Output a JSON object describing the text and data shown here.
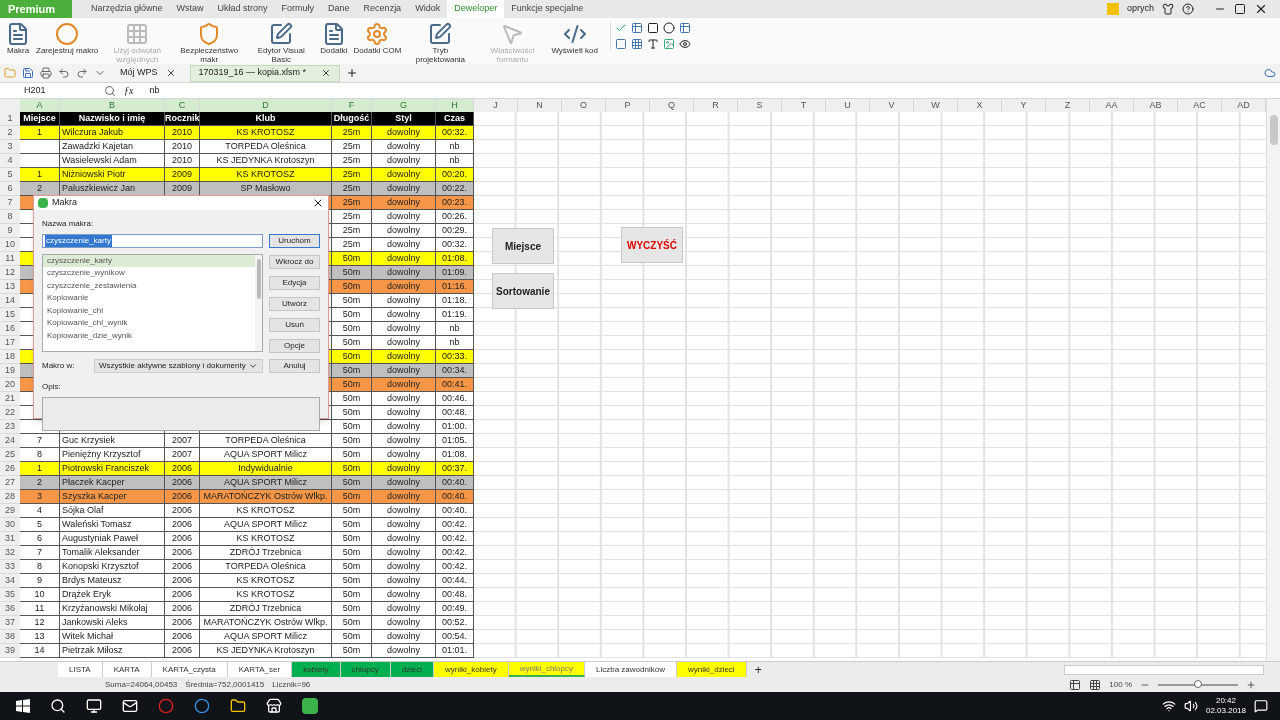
{
  "app": {
    "premium": "Premium",
    "user": "oprych"
  },
  "ribbon_tabs": [
    {
      "label": "Narzędzia główne",
      "selected": false
    },
    {
      "label": "Wstaw",
      "selected": false
    },
    {
      "label": "Układ strony",
      "selected": false
    },
    {
      "label": "Formuły",
      "selected": false
    },
    {
      "label": "Dane",
      "selected": false
    },
    {
      "label": "Recenzja",
      "selected": false
    },
    {
      "label": "Widok",
      "selected": false
    },
    {
      "label": "Deweloper",
      "selected": true
    },
    {
      "label": "Funkcje specjalne",
      "selected": false
    }
  ],
  "ribbon_buttons": [
    {
      "label": "Makra",
      "disabled": false,
      "kind": "macro"
    },
    {
      "label": "Zarejestruj makro",
      "disabled": false,
      "kind": "record"
    },
    {
      "label": "Użyj odwołań względnych",
      "disabled": true,
      "kind": "grid"
    },
    {
      "label": "Bezpieczeństwo makr",
      "disabled": false,
      "kind": "shield"
    },
    {
      "label": "Edytor Visual Basic",
      "disabled": false,
      "kind": "edit"
    },
    {
      "label": "Dodatki",
      "disabled": false,
      "kind": "addin"
    },
    {
      "label": "Dodatki COM",
      "disabled": false,
      "kind": "gear"
    },
    {
      "label": "Tryb projektowania",
      "disabled": false,
      "kind": "edit"
    },
    {
      "label": "Właściwości formantu",
      "disabled": true,
      "kind": "pointer"
    },
    {
      "label": "Wyświetl kod",
      "disabled": false,
      "kind": "code"
    }
  ],
  "doc_tabs": [
    {
      "label": "Mój WPS",
      "selected": false
    },
    {
      "label": "170319_16 — kopia.xlsm *",
      "selected": true
    }
  ],
  "name_box": "H201",
  "function_symbol": "ƒx",
  "formula": "nb",
  "columns": [
    {
      "label": "A",
      "selected": true
    },
    {
      "label": "B",
      "selected": true
    },
    {
      "label": "C",
      "selected": true
    },
    {
      "label": "D",
      "selected": true
    },
    {
      "label": "F",
      "selected": true
    },
    {
      "label": "G",
      "selected": true
    },
    {
      "label": "H",
      "selected": true
    },
    {
      "label": "J",
      "selected": false
    },
    {
      "label": "N",
      "selected": false
    },
    {
      "label": "O",
      "selected": false
    },
    {
      "label": "P",
      "selected": false
    },
    {
      "label": "Q",
      "selected": false
    },
    {
      "label": "R",
      "selected": false
    },
    {
      "label": "S",
      "selected": false
    },
    {
      "label": "T",
      "selected": false
    },
    {
      "label": "U",
      "selected": false
    },
    {
      "label": "V",
      "selected": false
    },
    {
      "label": "W",
      "selected": false
    },
    {
      "label": "X",
      "selected": false
    },
    {
      "label": "Y",
      "selected": false
    },
    {
      "label": "Z",
      "selected": false
    },
    {
      "label": "AA",
      "selected": false
    },
    {
      "label": "AB",
      "selected": false
    },
    {
      "label": "AC",
      "selected": false
    },
    {
      "label": "AD",
      "selected": false
    }
  ],
  "rows": [
    {
      "n": "1",
      "kind": "header",
      "color": "#000000",
      "miejsce": "Miejsce",
      "nazwisko": "Nazwisko i imię",
      "rocznik": "Rocznik",
      "klub": "Klub",
      "dlugosc": "Długość",
      "styl": "Styl",
      "czas": "Czas"
    },
    {
      "n": "2",
      "kind": "data",
      "color": "#ffff00",
      "miejsce": "1",
      "nazwisko": "Wilczura Jakub",
      "rocznik": "2010",
      "klub": "KS KROTOSZ",
      "dlugosc": "25m",
      "styl": "dowolny",
      "czas": "00:32."
    },
    {
      "n": "3",
      "kind": "data",
      "color": "#ffffff",
      "nazwisko": "Zawadzki Kajetan",
      "rocznik": "2010",
      "klub": "TORPEDA Oleśnica",
      "dlugosc": "25m",
      "styl": "dowolny",
      "czas": "nb"
    },
    {
      "n": "4",
      "kind": "data",
      "color": "#ffffff",
      "nazwisko": "Wasielewski Adam",
      "rocznik": "2010",
      "klub": "KS JEDYNKA Krotoszyn",
      "dlugosc": "25m",
      "styl": "dowolny",
      "czas": "nb"
    },
    {
      "n": "5",
      "kind": "data",
      "color": "#ffff00",
      "miejsce": "1",
      "nazwisko": "Niżniowski Piotr",
      "rocznik": "2009",
      "klub": "KS KROTOSZ",
      "dlugosc": "25m",
      "styl": "dowolny",
      "czas": "00:20."
    },
    {
      "n": "6",
      "kind": "data",
      "color": "#bfbfbf",
      "miejsce": "2",
      "nazwisko": "Paluszkiewicz Jan",
      "rocznik": "2009",
      "klub": "SP Masłowo",
      "dlugosc": "25m",
      "styl": "dowolny",
      "czas": "00:22."
    },
    {
      "n": "7",
      "kind": "data",
      "color": "#f79646",
      "dlugosc": "25m",
      "styl": "dowolny",
      "czas": "00:23."
    },
    {
      "n": "8",
      "kind": "data",
      "color": "#ffffff",
      "dlugosc": "25m",
      "styl": "dowolny",
      "czas": "00:26."
    },
    {
      "n": "9",
      "kind": "data",
      "color": "#ffffff",
      "dlugosc": "25m",
      "styl": "dowolny",
      "czas": "00:29."
    },
    {
      "n": "10",
      "kind": "data",
      "color": "#ffffff",
      "dlugosc": "25m",
      "styl": "dowolny",
      "czas": "00:32."
    },
    {
      "n": "11",
      "kind": "data",
      "color": "#ffff00",
      "dlugosc": "50m",
      "styl": "dowolny",
      "czas": "01:08."
    },
    {
      "n": "12",
      "kind": "data",
      "color": "#bfbfbf",
      "dlugosc": "50m",
      "styl": "dowolny",
      "czas": "01:09."
    },
    {
      "n": "13",
      "kind": "data",
      "color": "#f79646",
      "dlugosc": "50m",
      "styl": "dowolny",
      "czas": "01:16."
    },
    {
      "n": "14",
      "kind": "data",
      "color": "#ffffff",
      "dlugosc": "50m",
      "styl": "dowolny",
      "czas": "01:18."
    },
    {
      "n": "15",
      "kind": "data",
      "color": "#ffffff",
      "dlugosc": "50m",
      "styl": "dowolny",
      "czas": "01:19."
    },
    {
      "n": "16",
      "kind": "data",
      "color": "#ffffff",
      "dlugosc": "50m",
      "styl": "dowolny",
      "czas": "nb"
    },
    {
      "n": "17",
      "kind": "data",
      "color": "#ffffff",
      "dlugosc": "50m",
      "styl": "dowolny",
      "czas": "nb"
    },
    {
      "n": "18",
      "kind": "data",
      "color": "#ffff00",
      "dlugosc": "50m",
      "styl": "dowolny",
      "czas": "00:33."
    },
    {
      "n": "19",
      "kind": "data",
      "color": "#bfbfbf",
      "dlugosc": "50m",
      "styl": "dowolny",
      "czas": "00:34."
    },
    {
      "n": "20",
      "kind": "data",
      "color": "#f79646",
      "dlugosc": "50m",
      "styl": "dowolny",
      "czas": "00:41."
    },
    {
      "n": "21",
      "kind": "data",
      "color": "#ffffff",
      "dlugosc": "50m",
      "styl": "dowolny",
      "czas": "00:46."
    },
    {
      "n": "22",
      "kind": "data",
      "color": "#ffffff",
      "dlugosc": "50m",
      "styl": "dowolny",
      "czas": "00:48."
    },
    {
      "n": "23",
      "kind": "data",
      "color": "#ffffff",
      "dlugosc": "50m",
      "styl": "dowolny",
      "czas": "01:00."
    },
    {
      "n": "24",
      "kind": "data",
      "color": "#ffffff",
      "miejsce": "7",
      "nazwisko": "Guc Krzysiek",
      "rocznik": "2007",
      "klub": "TORPEDA Oleśnica",
      "dlugosc": "50m",
      "styl": "dowolny",
      "czas": "01:05."
    },
    {
      "n": "25",
      "kind": "data",
      "color": "#ffffff",
      "miejsce": "8",
      "nazwisko": "Pieniężny Krzysztof",
      "rocznik": "2007",
      "klub": "AQUA SPORT Milicz",
      "dlugosc": "50m",
      "styl": "dowolny",
      "czas": "01:08."
    },
    {
      "n": "26",
      "kind": "data",
      "color": "#ffff00",
      "miejsce": "1",
      "nazwisko": "Piotrowski Franciszek",
      "rocznik": "2006",
      "klub": "Indywidualnie",
      "dlugosc": "50m",
      "styl": "dowolny",
      "czas": "00:37."
    },
    {
      "n": "27",
      "kind": "data",
      "color": "#bfbfbf",
      "miejsce": "2",
      "nazwisko": "Płaczek Kacper",
      "rocznik": "2006",
      "klub": "AQUA SPORT Milicz",
      "dlugosc": "50m",
      "styl": "dowolny",
      "czas": "00:40."
    },
    {
      "n": "28",
      "kind": "data",
      "color": "#f79646",
      "miejsce": "3",
      "nazwisko": "Szyszka Kacper",
      "rocznik": "2006",
      "klub": "MARATOŃCZYK Ostrów Wlkp.",
      "dlugosc": "50m",
      "styl": "dowolny",
      "czas": "00:40."
    },
    {
      "n": "29",
      "kind": "data",
      "color": "#ffffff",
      "miejsce": "4",
      "nazwisko": "Sójka Olaf",
      "rocznik": "2006",
      "klub": "KS KROTOSZ",
      "dlugosc": "50m",
      "styl": "dowolny",
      "czas": "00:40."
    },
    {
      "n": "30",
      "kind": "data",
      "color": "#ffffff",
      "miejsce": "5",
      "nazwisko": "Waleński Tomasz",
      "rocznik": "2006",
      "klub": "AQUA SPORT Milicz",
      "dlugosc": "50m",
      "styl": "dowolny",
      "czas": "00:42."
    },
    {
      "n": "31",
      "kind": "data",
      "color": "#ffffff",
      "miejsce": "6",
      "nazwisko": "Augustyniak Paweł",
      "rocznik": "2006",
      "klub": "KS KROTOSZ",
      "dlugosc": "50m",
      "styl": "dowolny",
      "czas": "00:42."
    },
    {
      "n": "32",
      "kind": "data",
      "color": "#ffffff",
      "miejsce": "7",
      "nazwisko": "Tomalik Aleksander",
      "rocznik": "2006",
      "klub": "ZDRÓJ Trzebnica",
      "dlugosc": "50m",
      "styl": "dowolny",
      "czas": "00:42."
    },
    {
      "n": "33",
      "kind": "data",
      "color": "#ffffff",
      "miejsce": "8",
      "nazwisko": "Konopski Krzysztof",
      "rocznik": "2006",
      "klub": "TORPEDA Oleśnica",
      "dlugosc": "50m",
      "styl": "dowolny",
      "czas": "00:42."
    },
    {
      "n": "34",
      "kind": "data",
      "color": "#ffffff",
      "miejsce": "9",
      "nazwisko": "Brdys Mateusz",
      "rocznik": "2006",
      "klub": "KS KROTOSZ",
      "dlugosc": "50m",
      "styl": "dowolny",
      "czas": "00:44."
    },
    {
      "n": "35",
      "kind": "data",
      "color": "#ffffff",
      "miejsce": "10",
      "nazwisko": "Drążek Eryk",
      "rocznik": "2006",
      "klub": "KS KROTOSZ",
      "dlugosc": "50m",
      "styl": "dowolny",
      "czas": "00:48."
    },
    {
      "n": "36",
      "kind": "data",
      "color": "#ffffff",
      "miejsce": "11",
      "nazwisko": "Krzyżanowski Mikołaj",
      "rocznik": "2006",
      "klub": "ZDRÓJ Trzebnica",
      "dlugosc": "50m",
      "styl": "dowolny",
      "czas": "00:49."
    },
    {
      "n": "37",
      "kind": "data",
      "color": "#ffffff",
      "miejsce": "12",
      "nazwisko": "Jankowski Aleks",
      "rocznik": "2006",
      "klub": "MARATOŃCZYK Ostrów Wlkp.",
      "dlugosc": "50m",
      "styl": "dowolny",
      "czas": "00:52."
    },
    {
      "n": "38",
      "kind": "data",
      "color": "#ffffff",
      "miejsce": "13",
      "nazwisko": "Witek Michał",
      "rocznik": "2006",
      "klub": "AQUA SPORT Milicz",
      "dlugosc": "50m",
      "styl": "dowolny",
      "czas": "00:54."
    },
    {
      "n": "39",
      "kind": "data",
      "color": "#ffffff",
      "miejsce": "14",
      "nazwisko": "Pietrzak Miłosz",
      "rocznik": "2006",
      "klub": "KS JEDYNKA Krotoszyn",
      "dlugosc": "50m",
      "styl": "dowolny",
      "czas": "01:01."
    }
  ],
  "sheet_buttons": [
    {
      "label": "Miejsce",
      "kind": "plain"
    },
    {
      "label": "Sortowanie",
      "kind": "plain"
    },
    {
      "label": "WYCZYŚĆ",
      "kind": "danger"
    }
  ],
  "dialog": {
    "title": "Makra",
    "name_label": "Nazwa makra:",
    "name_value": "czyszczenie_karty",
    "macros": [
      {
        "label": "czyszczenie_karty",
        "selected": true
      },
      {
        "label": "czyszczenie_wynikow",
        "selected": false
      },
      {
        "label": "czyszczenie_zestawienia",
        "selected": false
      },
      {
        "label": "Kopiowanie",
        "selected": false
      },
      {
        "label": "Kopiowanie_chl",
        "selected": false
      },
      {
        "label": "Kopiowanie_chl_wynik",
        "selected": false
      },
      {
        "label": "Kopiowanie_dzie_wynik",
        "selected": false
      }
    ],
    "buttons": [
      {
        "label": "Uruchom",
        "kind": "default"
      },
      {
        "label": "Wkrocz do",
        "kind": "plain"
      },
      {
        "label": "Edycja",
        "kind": "plain"
      },
      {
        "label": "Utwórz",
        "kind": "plain"
      },
      {
        "label": "Usuń",
        "kind": "plain"
      },
      {
        "label": "Opcje",
        "kind": "plain"
      }
    ],
    "cancel": "Anuluj",
    "location_label": "Makro w:",
    "location_value": "Wszystkie aktywne szablony i dokumenty",
    "description_label": "Opis:"
  },
  "sheet_tabs": [
    {
      "label": "LISTA",
      "color": "#ffffff",
      "selected": false
    },
    {
      "label": "KARTA",
      "color": "#ffffff",
      "selected": false
    },
    {
      "label": "KARTA_czysta",
      "color": "#ffffff",
      "selected": false
    },
    {
      "label": "KARTA_ser",
      "color": "#ffffff",
      "selected": false
    },
    {
      "label": "kobiety",
      "color": "#00b050",
      "selected": false
    },
    {
      "label": "chlopcy",
      "color": "#00b050",
      "selected": false
    },
    {
      "label": "dzieci",
      "color": "#00b050",
      "selected": false
    },
    {
      "label": "wyniki_kobiety",
      "color": "#ffff00",
      "selected": false
    },
    {
      "label": "wyniki_chlopcy",
      "color": "#ffff00",
      "selected": true
    },
    {
      "label": "Liczba zawodników",
      "color": "#ffffff",
      "selected": false
    },
    {
      "label": "wyniki_dzieci",
      "color": "#ffff00",
      "selected": false
    }
  ],
  "add_sheet": "+",
  "status": {
    "sum": "Suma=24064,00453",
    "average": "Średnia=752,0001415",
    "count": "Licznik=96",
    "zoom": "100 %",
    "level": 0.5
  },
  "taskbar": {
    "time": "20:42",
    "date": "02.03.2018"
  }
}
